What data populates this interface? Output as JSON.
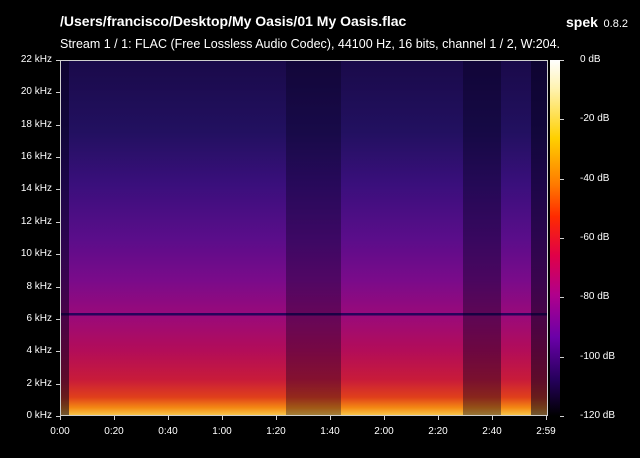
{
  "header": {
    "title": "/Users/francisco/Desktop/My Oasis/01 My Oasis.flac",
    "app_name": "spek",
    "app_version": "0.8.2",
    "stream_info": "Stream 1 / 1: FLAC (Free Lossless Audio Codec), 44100 Hz, 16 bits, channel 1 / 2, W:204..."
  },
  "y_axis": [
    "22 kHz",
    "20 kHz",
    "18 kHz",
    "16 kHz",
    "14 kHz",
    "12 kHz",
    "10 kHz",
    "8 kHz",
    "6 kHz",
    "4 kHz",
    "2 kHz",
    "0 kHz"
  ],
  "x_axis": [
    "0:00",
    "0:20",
    "0:40",
    "1:00",
    "1:20",
    "1:40",
    "2:00",
    "2:20",
    "2:40",
    "2:59"
  ],
  "colorbar": [
    "0 dB",
    "-20 dB",
    "-40 dB",
    "-60 dB",
    "-80 dB",
    "-100 dB",
    "-120 dB"
  ],
  "colors": {
    "background": "#000000",
    "frame": "#cfcfcf"
  }
}
